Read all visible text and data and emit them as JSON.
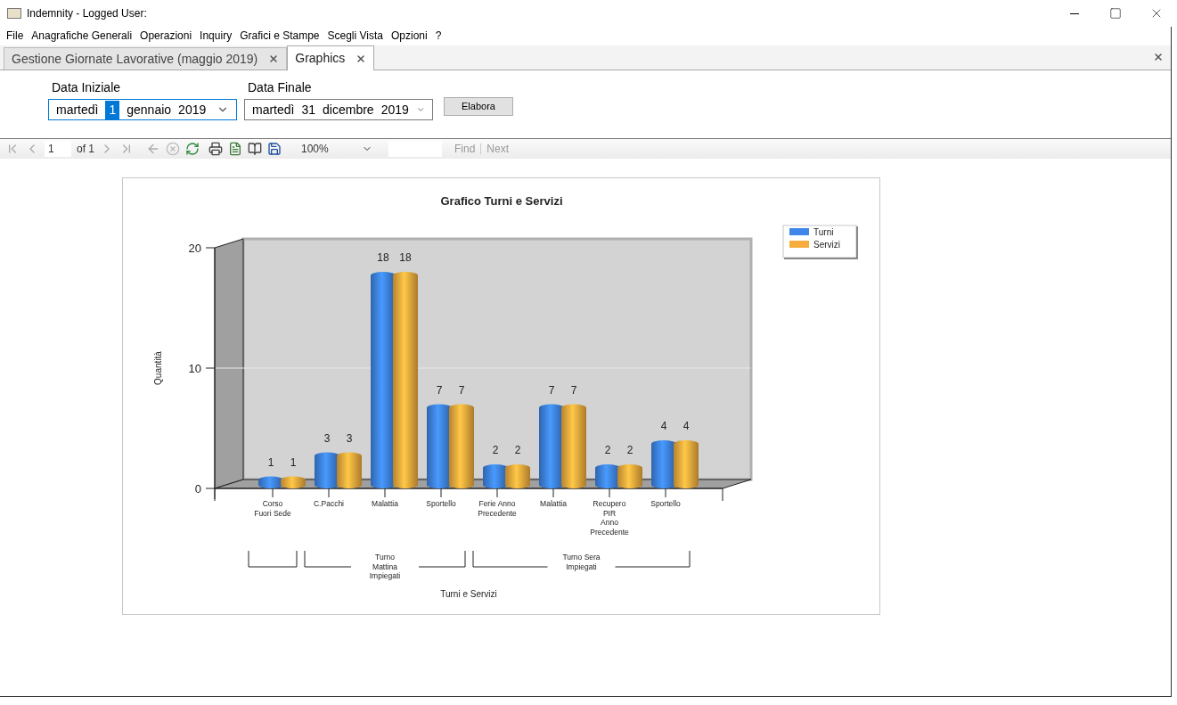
{
  "window": {
    "title": "Indemnity - Logged User:"
  },
  "menu": [
    "File",
    "Anagrafiche Generali",
    "Operazioni",
    "Inquiry",
    "Grafici e Stampe",
    "Scegli Vista",
    "Opzioni",
    "?"
  ],
  "tabs": [
    {
      "label": "Gestione Giornate Lavorative (maggio 2019)",
      "selected": false
    },
    {
      "label": "Graphics",
      "selected": true
    }
  ],
  "form": {
    "start": {
      "label": "Data Iniziale",
      "focused": true,
      "parts": [
        {
          "text": "martedì",
          "selected": false
        },
        {
          "text": "1",
          "selected": true
        },
        {
          "text": "gennaio",
          "selected": false
        },
        {
          "text": "2019",
          "selected": false
        }
      ]
    },
    "end": {
      "label": "Data Finale",
      "focused": false,
      "parts": [
        {
          "text": "martedì",
          "selected": false
        },
        {
          "text": "31",
          "selected": false
        },
        {
          "text": "dicembre",
          "selected": false
        },
        {
          "text": "2019",
          "selected": false
        }
      ]
    },
    "button": "Elabora"
  },
  "toolbar": {
    "page": "1",
    "page_count": "of 1",
    "zoom": "100%",
    "find": "Find",
    "next": "Next"
  },
  "chart": {
    "chart_data": {
      "type": "bar",
      "title": "Grafico Turni e Servizi",
      "ylabel": "Quantità",
      "categories": [
        "Corso\nFuori Sede",
        "C.Pacchi",
        "Malattia",
        "Sportello",
        "Ferie Anno\nPrecedente",
        "Malattia",
        "Recupero\nPIR\nAnno\nPrecedente",
        "Sportello"
      ],
      "series": [
        {
          "name": "Turni",
          "color": "#3f86e8",
          "values": [
            1,
            3,
            18,
            7,
            2,
            7,
            2,
            4
          ]
        },
        {
          "name": "Servizi",
          "color": "#f5ae3e",
          "values": [
            1,
            3,
            18,
            7,
            2,
            7,
            2,
            4
          ]
        }
      ],
      "ylim": [
        0,
        20
      ],
      "yticks": [
        0,
        10,
        20
      ],
      "data_labels": true,
      "grid": true,
      "legend": true,
      "annotations": [
        {
          "text": "Turni e Servizi"
        }
      ]
    },
    "groups": [
      {
        "kind": "unlabeled"
      },
      {
        "kind": "labeled",
        "label": "Turno\nMattina\nImpiegati"
      },
      {
        "kind": "labeled",
        "label": "Turno Sera\nImpiegati"
      }
    ]
  }
}
